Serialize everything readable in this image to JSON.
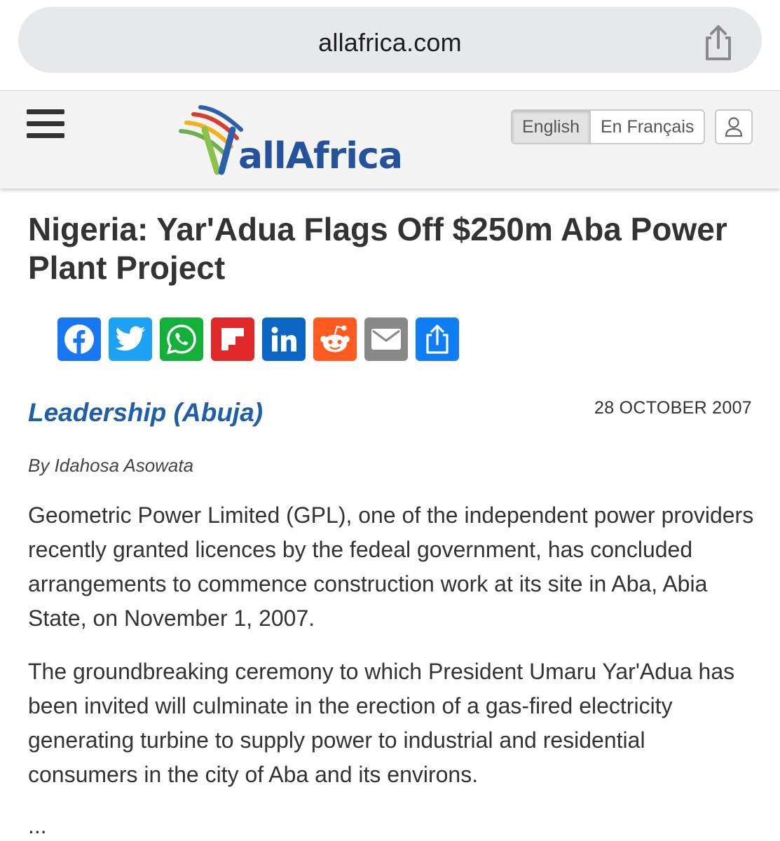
{
  "browser": {
    "url": "allafrica.com",
    "share_icon": "share-icon"
  },
  "header": {
    "menu_icon": "hamburger-menu-icon",
    "logo_text": "allAfrica",
    "languages": [
      {
        "label": "English",
        "active": true
      },
      {
        "label": "En Français",
        "active": false
      }
    ],
    "user_icon": "user-icon"
  },
  "article": {
    "title": "Nigeria: Yar'Adua Flags Off $250m Aba Power Plant Project",
    "share_buttons": [
      {
        "name": "facebook",
        "icon": "facebook-icon",
        "color": "#1877f2"
      },
      {
        "name": "twitter",
        "icon": "twitter-icon",
        "color": "#1da1f2"
      },
      {
        "name": "whatsapp",
        "icon": "whatsapp-icon",
        "color": "#13b13a"
      },
      {
        "name": "flipboard",
        "icon": "flipboard-icon",
        "color": "#e12828"
      },
      {
        "name": "linkedin",
        "icon": "linkedin-icon",
        "color": "#0a66c2"
      },
      {
        "name": "reddit",
        "icon": "reddit-icon",
        "color": "#ff5a1f"
      },
      {
        "name": "email",
        "icon": "email-icon",
        "color": "#888888"
      },
      {
        "name": "share",
        "icon": "share-icon",
        "color": "#0f7ef5"
      }
    ],
    "source": "Leadership (Abuja)",
    "date": "28 OCTOBER 2007",
    "byline": "By Idahosa Asowata",
    "paragraphs": [
      "Geometric Power Limited (GPL), one of the independent power providers recently granted licences by the fedeal government, has concluded arrangements to commence construction work at its site in Aba, Abia State, on November 1, 2007.",
      "The groundbreaking ceremony to which President Umaru Yar'Adua has been invited will culminate in the erection of a gas-fired electricity generating turbine to supply power to industrial and residential consumers in the city of Aba and its environs."
    ],
    "more": "..."
  }
}
